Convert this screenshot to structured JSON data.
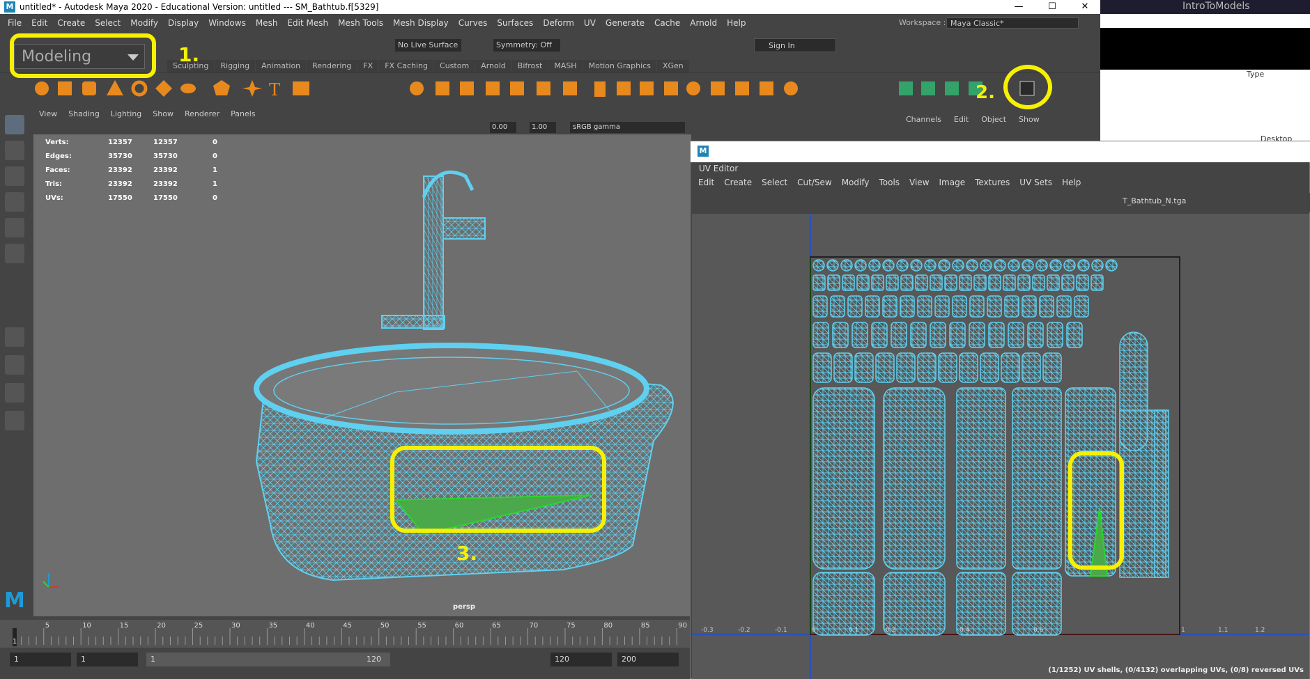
{
  "titlebar": {
    "title": "untitled* - Autodesk Maya 2020 - Educational Version: untitled   ---   SM_Bathtub.f[5329]",
    "min": "—",
    "max": "☐",
    "close": "✕"
  },
  "menubar": {
    "items": [
      "File",
      "Edit",
      "Create",
      "Select",
      "Modify",
      "Display",
      "Windows",
      "Mesh",
      "Edit Mesh",
      "Mesh Tools",
      "Mesh Display",
      "Curves",
      "Surfaces",
      "Deform",
      "UV",
      "Generate",
      "Cache",
      "Arnold",
      "Help"
    ],
    "workspace_label": "Workspace :",
    "workspace_value": "Maya Classic*"
  },
  "statusline": {
    "mode": "Modeling",
    "live_surface": "No Live Surface",
    "symmetry": "Symmetry: Off",
    "sign_in": "Sign In"
  },
  "shelf_tabs": [
    "Sculpting",
    "Rigging",
    "Animation",
    "Rendering",
    "FX",
    "FX Caching",
    "Custom",
    "Arnold",
    "Bifrost",
    "MASH",
    "Motion Graphics",
    "XGen"
  ],
  "viewport": {
    "menu": [
      "View",
      "Shading",
      "Lighting",
      "Show",
      "Renderer",
      "Panels"
    ],
    "exposure": "0.00",
    "gamma": "1.00",
    "colorspace": "sRGB gamma",
    "camera": "persp",
    "hud": [
      {
        "label": "Verts:",
        "a": "12357",
        "b": "12357",
        "c": "0"
      },
      {
        "label": "Edges:",
        "a": "35730",
        "b": "35730",
        "c": "0"
      },
      {
        "label": "Faces:",
        "a": "23392",
        "b": "23392",
        "c": "1"
      },
      {
        "label": "Tris:",
        "a": "23392",
        "b": "23392",
        "c": "1"
      },
      {
        "label": "UVs:",
        "a": "17550",
        "b": "17550",
        "c": "0"
      }
    ]
  },
  "timeline": {
    "ticks": [
      "5",
      "10",
      "15",
      "20",
      "25",
      "30",
      "35",
      "40",
      "45",
      "50",
      "55",
      "60",
      "65",
      "70",
      "75",
      "80",
      "85",
      "90"
    ],
    "current": "1",
    "range_start": "1",
    "range_inner_start": "1",
    "range_slider_start": "1",
    "range_slider_end": "120",
    "range_end": "120",
    "anim_end": "200"
  },
  "channel_box": {
    "tabs": [
      "Channels",
      "Edit",
      "Object",
      "Show"
    ]
  },
  "background_app": {
    "title": "IntroToModels",
    "label_type": "Type",
    "desktop": "Desktop"
  },
  "uv_editor": {
    "title": "UV Editor",
    "menu": [
      "Edit",
      "Create",
      "Select",
      "Cut/Sew",
      "Modify",
      "Tools",
      "View",
      "Image",
      "Textures",
      "UV Sets",
      "Help"
    ],
    "image": "T_Bathtub_N.tga",
    "status": "(1/1252) UV shells, (0/4132) overlapping UVs, (0/8) reversed UVs",
    "axis_labels": [
      "-0.3",
      "-0.2",
      "-0.1",
      "0",
      "0.1",
      "0.2",
      "0.4",
      "0.6",
      "1",
      "1.1",
      "1.2"
    ]
  },
  "annotations": [
    "1.",
    "2.",
    "3."
  ],
  "colors": {
    "accent_annotation": "#f7f000",
    "wire": "#5fd0f0",
    "maya_blue": "#1e84b6",
    "selected_face": "#2bd62b"
  }
}
